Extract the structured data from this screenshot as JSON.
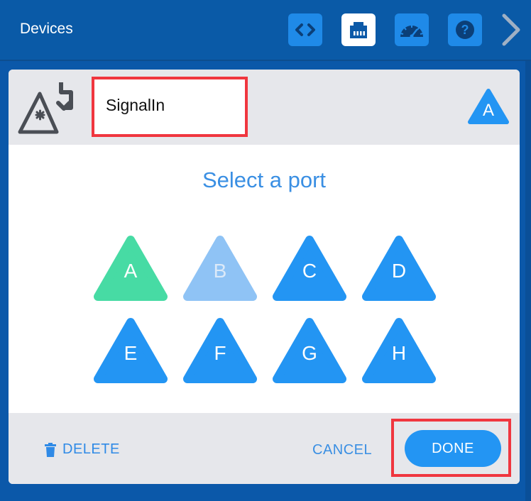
{
  "header": {
    "title": "Devices",
    "toolbar": [
      {
        "icon": "code-icon",
        "active": false
      },
      {
        "icon": "ethernet-port-icon",
        "active": true
      },
      {
        "icon": "dashboard-gauge-icon",
        "active": false
      },
      {
        "icon": "help-icon",
        "active": false
      }
    ],
    "next_icon": "chevron-right-icon"
  },
  "device": {
    "icon": "signal-input-icon",
    "name": "SignalIn",
    "assigned_port": "A"
  },
  "port_picker": {
    "prompt": "Select a port",
    "ports": [
      {
        "label": "A",
        "state": "selected"
      },
      {
        "label": "B",
        "state": "disabled"
      },
      {
        "label": "C",
        "state": "available"
      },
      {
        "label": "D",
        "state": "available"
      },
      {
        "label": "E",
        "state": "available"
      },
      {
        "label": "F",
        "state": "available"
      },
      {
        "label": "G",
        "state": "available"
      },
      {
        "label": "H",
        "state": "available"
      }
    ]
  },
  "footer": {
    "delete_label": "DELETE",
    "cancel_label": "CANCEL",
    "done_label": "DONE"
  },
  "colors": {
    "header_bg": "#0a5aa7",
    "accent": "#2395f3",
    "selected": "#47dba4",
    "disabled": "#8fc3f5",
    "highlight_border": "#f0363f"
  }
}
